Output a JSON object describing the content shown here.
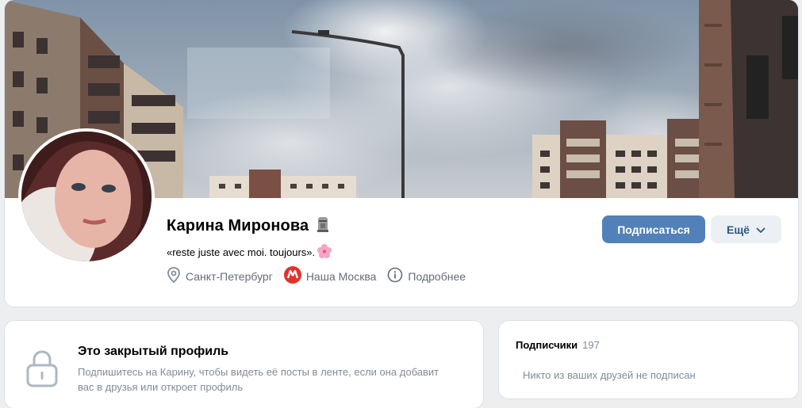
{
  "profile": {
    "name": "Карина Миронова",
    "name_badge_icon": "moai-emoji-icon",
    "status": "«reste juste avec moi. toujours».",
    "status_emoji_icon": "cherry-blossom-icon",
    "city": "Санкт-Петербург",
    "group": "Наша Москва",
    "more_info": "Подробнее"
  },
  "actions": {
    "subscribe_label": "Подписаться",
    "more_label": "Ещё"
  },
  "closed_profile": {
    "title": "Это закрытый профиль",
    "text": "Подпишитесь на Карину, чтобы видеть её посты в ленте, если она добавит вас в друзья или откроет профиль"
  },
  "followers": {
    "title": "Подписчики",
    "count": "197",
    "empty_text": "Никто из ваших друзей не подписан"
  },
  "colors": {
    "accent": "#5181b8",
    "link": "#2a5885",
    "secondary_text": "#818c99",
    "metro_red": "#e4312b"
  }
}
